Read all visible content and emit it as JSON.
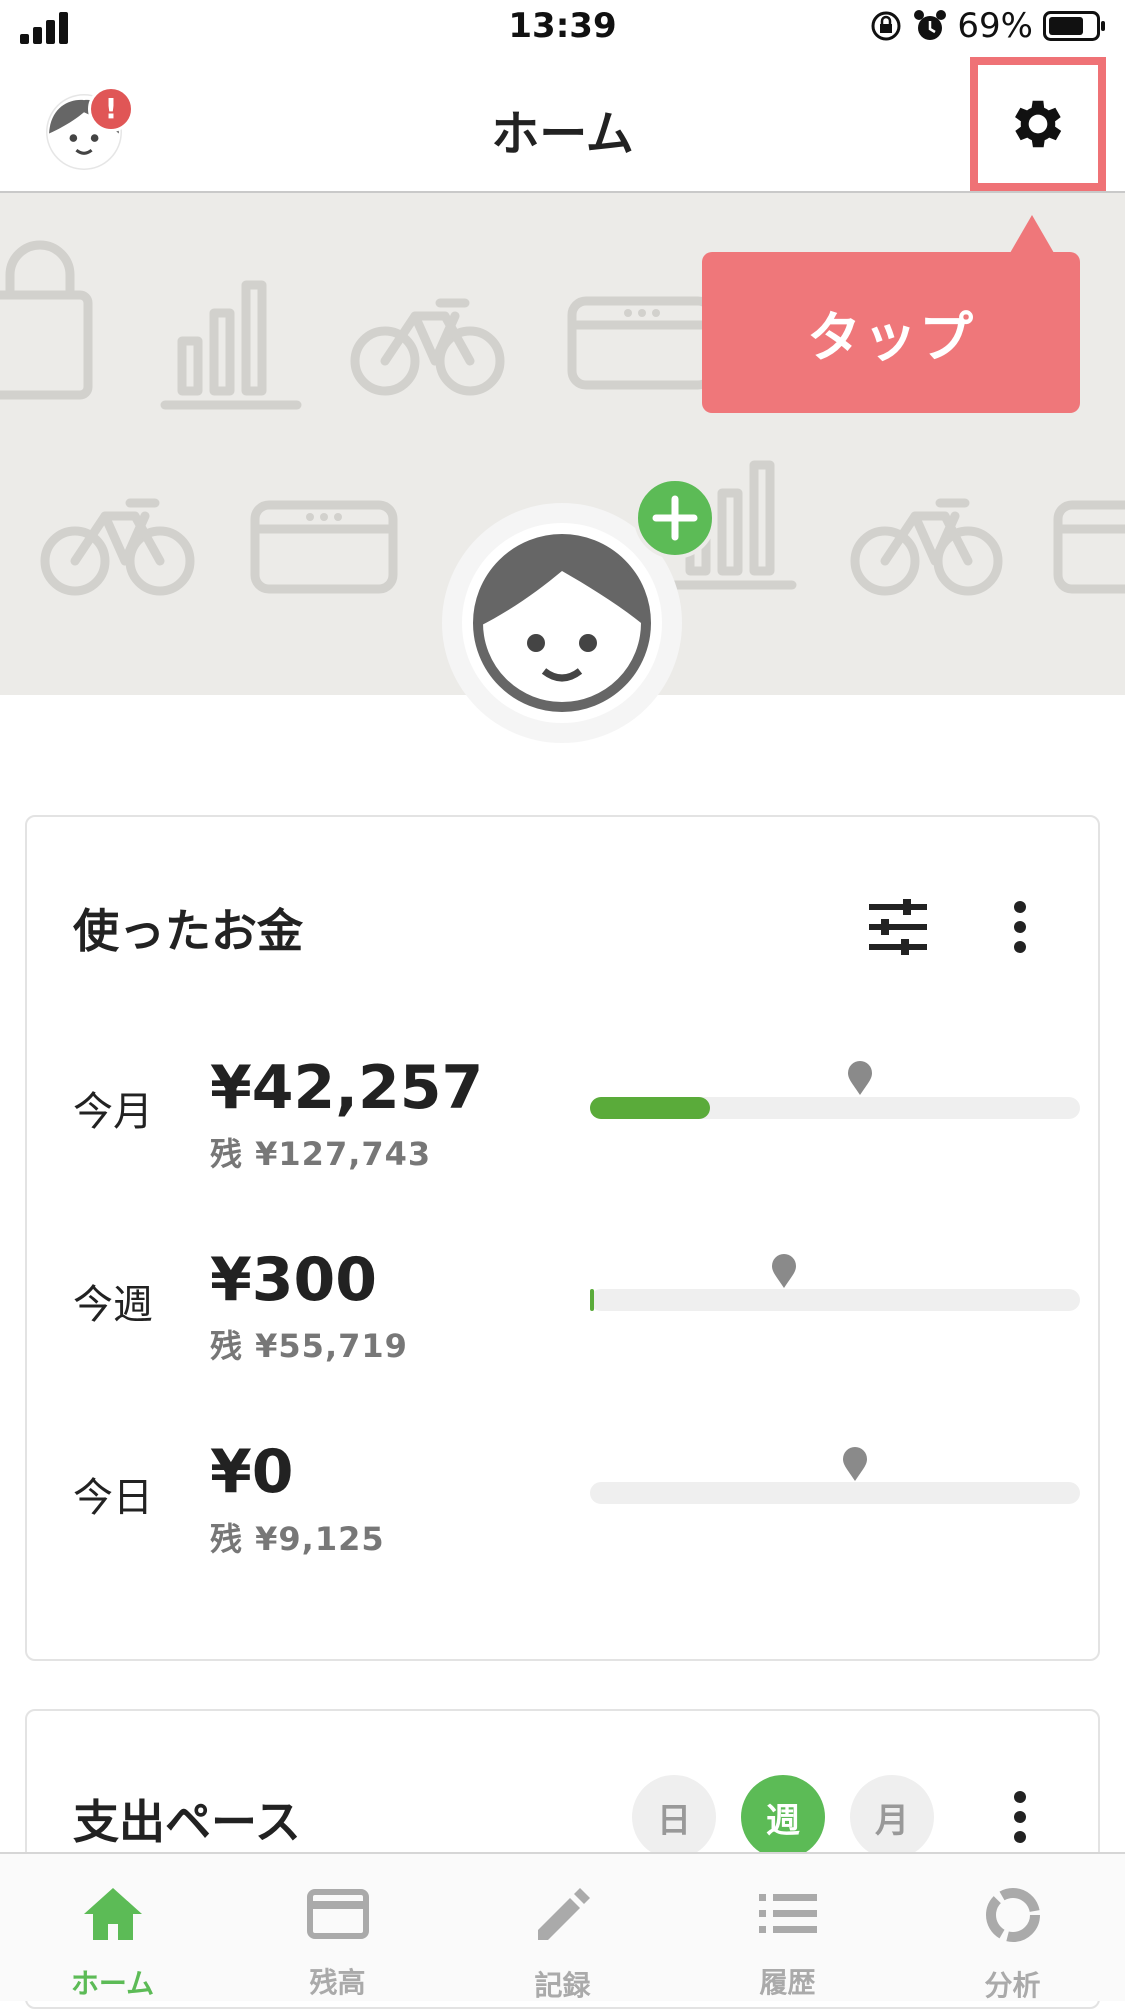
{
  "status_bar": {
    "time": "13:39",
    "battery": "69%"
  },
  "nav": {
    "title": "ホーム",
    "alert": "!"
  },
  "hero": {
    "tooltip": "タップ"
  },
  "spending_card": {
    "title": "使ったお金",
    "rows": [
      {
        "label": "今月",
        "amount": "¥42,257",
        "remaining": "残 ¥127,743",
        "progress": 0.245,
        "marker": 0.55
      },
      {
        "label": "今週",
        "amount": "¥300",
        "remaining": "残 ¥55,719",
        "progress": 0.005,
        "marker": 0.395
      },
      {
        "label": "今日",
        "amount": "¥0",
        "remaining": "残 ¥9,125",
        "progress": 0.0,
        "marker": 0.54
      }
    ]
  },
  "pace_card": {
    "title": "支出ペース",
    "segments": [
      {
        "label": "日",
        "active": false
      },
      {
        "label": "週",
        "active": true
      },
      {
        "label": "月",
        "active": false
      }
    ]
  },
  "tabs": [
    {
      "label": "ホーム",
      "icon": "home-icon",
      "active": true
    },
    {
      "label": "残高",
      "icon": "card-icon",
      "active": false
    },
    {
      "label": "記録",
      "icon": "pencil-icon",
      "active": false
    },
    {
      "label": "履歴",
      "icon": "list-icon",
      "active": false
    },
    {
      "label": "分析",
      "icon": "chart-ring-icon",
      "active": false
    }
  ],
  "colors": {
    "accent_green": "#5cbb56",
    "highlight_red": "#ef7276",
    "bar_green": "#5aab3a"
  }
}
